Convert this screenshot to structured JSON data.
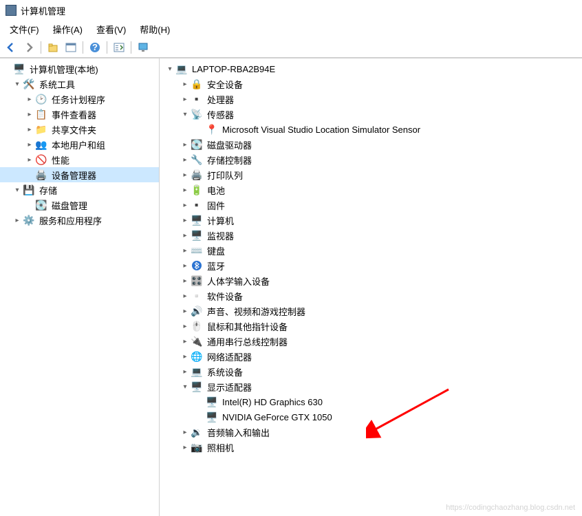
{
  "title": "计算机管理",
  "menu": {
    "file": "文件(F)",
    "action": "操作(A)",
    "view": "查看(V)",
    "help": "帮助(H)"
  },
  "left_tree": {
    "root": "计算机管理(本地)",
    "system_tools": "系统工具",
    "task_scheduler": "任务计划程序",
    "event_viewer": "事件查看器",
    "shared_folders": "共享文件夹",
    "local_users_groups": "本地用户和组",
    "performance": "性能",
    "device_manager": "设备管理器",
    "storage": "存储",
    "disk_management": "磁盘管理",
    "services_apps": "服务和应用程序"
  },
  "right_tree": {
    "computer_name": "LAPTOP-RBA2B94E",
    "security_devices": "安全设备",
    "processors": "处理器",
    "sensors": "传感器",
    "sensor_item": "Microsoft Visual Studio Location Simulator Sensor",
    "disk_drives": "磁盘驱动器",
    "storage_controllers": "存储控制器",
    "print_queues": "打印队列",
    "batteries": "电池",
    "firmware": "固件",
    "computer": "计算机",
    "monitors": "监视器",
    "keyboards": "键盘",
    "bluetooth": "蓝牙",
    "hid": "人体学输入设备",
    "software_devices": "软件设备",
    "sound_video_game": "声音、视频和游戏控制器",
    "mice": "鼠标和其他指针设备",
    "usb_controllers": "通用串行总线控制器",
    "network_adapters": "网络适配器",
    "system_devices": "系统设备",
    "display_adapters": "显示适配器",
    "gpu_intel": "Intel(R) HD Graphics 630",
    "gpu_nvidia": "NVIDIA GeForce GTX 1050",
    "audio_inputs_outputs": "音频输入和输出",
    "cameras": "照相机"
  },
  "watermark": "https://codingchaozhang.blog.csdn.net"
}
